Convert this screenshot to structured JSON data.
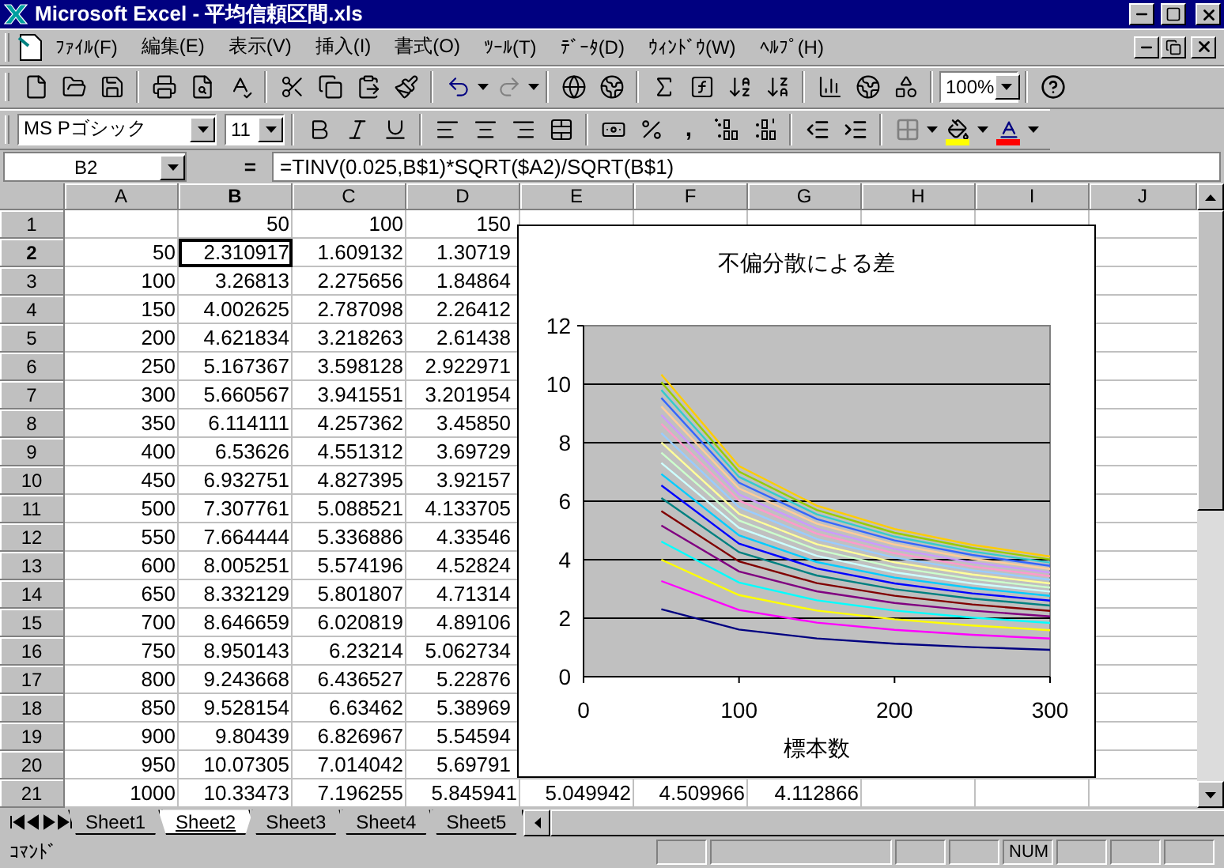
{
  "window": {
    "title": "Microsoft Excel - 平均信頼区間.xls"
  },
  "menu": [
    "ﾌｧｲﾙ(F)",
    "編集(E)",
    "表示(V)",
    "挿入(I)",
    "書式(O)",
    "ﾂｰﾙ(T)",
    "ﾃﾞｰﾀ(D)",
    "ｳｨﾝﾄﾞｳ(W)",
    "ﾍﾙﾌﾟ(H)"
  ],
  "toolbar": {
    "zoom": "100%",
    "font": "MS Pゴシック",
    "size": "11",
    "comma": ","
  },
  "formula_bar": {
    "name_box": "B2",
    "equals": "=",
    "formula": "=TINV(0.025,B$1)*SQRT($A2)/SQRT(B$1)"
  },
  "columns": [
    {
      "label": "A",
      "selected": false
    },
    {
      "label": "B",
      "selected": true
    },
    {
      "label": "C",
      "selected": false
    },
    {
      "label": "D",
      "selected": false
    },
    {
      "label": "E",
      "selected": false
    },
    {
      "label": "F",
      "selected": false
    },
    {
      "label": "G",
      "selected": false
    },
    {
      "label": "H",
      "selected": false
    },
    {
      "label": "I",
      "selected": false
    },
    {
      "label": "J",
      "selected": false
    }
  ],
  "rows": [
    {
      "header": "1",
      "selected": false,
      "cells": [
        null,
        "50",
        "100",
        "150"
      ]
    },
    {
      "header": "2",
      "selected": true,
      "cells": [
        "50",
        "2.310917",
        "1.609132",
        "1.30719"
      ]
    },
    {
      "header": "3",
      "selected": false,
      "cells": [
        "100",
        "3.26813",
        "2.275656",
        "1.84864"
      ]
    },
    {
      "header": "4",
      "selected": false,
      "cells": [
        "150",
        "4.002625",
        "2.787098",
        "2.26412"
      ]
    },
    {
      "header": "5",
      "selected": false,
      "cells": [
        "200",
        "4.621834",
        "3.218263",
        "2.61438"
      ]
    },
    {
      "header": "6",
      "selected": false,
      "cells": [
        "250",
        "5.167367",
        "3.598128",
        "2.922971"
      ]
    },
    {
      "header": "7",
      "selected": false,
      "cells": [
        "300",
        "5.660567",
        "3.941551",
        "3.201954"
      ]
    },
    {
      "header": "8",
      "selected": false,
      "cells": [
        "350",
        "6.114111",
        "4.257362",
        "3.45850"
      ]
    },
    {
      "header": "9",
      "selected": false,
      "cells": [
        "400",
        "6.53626",
        "4.551312",
        "3.69729"
      ]
    },
    {
      "header": "10",
      "selected": false,
      "cells": [
        "450",
        "6.932751",
        "4.827395",
        "3.92157"
      ]
    },
    {
      "header": "11",
      "selected": false,
      "cells": [
        "500",
        "7.307761",
        "5.088521",
        "4.133705"
      ]
    },
    {
      "header": "12",
      "selected": false,
      "cells": [
        "550",
        "7.664444",
        "5.336886",
        "4.33546"
      ]
    },
    {
      "header": "13",
      "selected": false,
      "cells": [
        "600",
        "8.005251",
        "5.574196",
        "4.52824"
      ]
    },
    {
      "header": "14",
      "selected": false,
      "cells": [
        "650",
        "8.332129",
        "5.801807",
        "4.71314"
      ]
    },
    {
      "header": "15",
      "selected": false,
      "cells": [
        "700",
        "8.646659",
        "6.020819",
        "4.89106"
      ]
    },
    {
      "header": "16",
      "selected": false,
      "cells": [
        "750",
        "8.950143",
        "6.23214",
        "5.062734"
      ]
    },
    {
      "header": "17",
      "selected": false,
      "cells": [
        "800",
        "9.243668",
        "6.436527",
        "5.22876"
      ]
    },
    {
      "header": "18",
      "selected": false,
      "cells": [
        "850",
        "9.528154",
        "6.63462",
        "5.38969"
      ]
    },
    {
      "header": "19",
      "selected": false,
      "cells": [
        "900",
        "9.80439",
        "6.826967",
        "5.54594"
      ]
    },
    {
      "header": "20",
      "selected": false,
      "cells": [
        "950",
        "10.07305",
        "7.014042",
        "5.69791"
      ]
    },
    {
      "header": "21",
      "selected": false,
      "cells": [
        "1000",
        "10.33473",
        "7.196255",
        "5.845941",
        "5.049942",
        "4.509966",
        "4.112866"
      ]
    }
  ],
  "chart": {
    "chart_data": {
      "type": "line",
      "grid": true,
      "title": "不偏分散による差",
      "xlabel": "標本数",
      "x": [
        50,
        100,
        150,
        200,
        250,
        300
      ],
      "xlim": [
        0,
        300
      ],
      "ylim": [
        0,
        12
      ],
      "xticks": [
        0,
        100,
        200,
        300
      ],
      "yticks": [
        0,
        2,
        4,
        6,
        8,
        10,
        12
      ],
      "series": [
        {
          "color": "#000080",
          "values": [
            2.31,
            1.61,
            1.31,
            1.13,
            1.01,
            0.92
          ]
        },
        {
          "color": "#ff00ff",
          "values": [
            3.27,
            2.28,
            1.85,
            1.6,
            1.43,
            1.3
          ]
        },
        {
          "color": "#ffff00",
          "values": [
            4.0,
            2.79,
            2.26,
            1.96,
            1.75,
            1.59
          ]
        },
        {
          "color": "#00ffff",
          "values": [
            4.62,
            3.22,
            2.61,
            2.26,
            2.02,
            1.84
          ]
        },
        {
          "color": "#800080",
          "values": [
            5.17,
            3.6,
            2.92,
            2.52,
            2.26,
            2.06
          ]
        },
        {
          "color": "#800000",
          "values": [
            5.66,
            3.94,
            3.2,
            2.77,
            2.47,
            2.25
          ]
        },
        {
          "color": "#008080",
          "values": [
            6.11,
            4.26,
            3.46,
            2.99,
            2.67,
            2.43
          ]
        },
        {
          "color": "#0000ff",
          "values": [
            6.54,
            4.55,
            3.7,
            3.19,
            2.85,
            2.6
          ]
        },
        {
          "color": "#00ccff",
          "values": [
            6.93,
            4.83,
            3.92,
            3.39,
            3.03,
            2.76
          ]
        },
        {
          "color": "#ccffff",
          "values": [
            7.31,
            5.09,
            4.13,
            3.57,
            3.19,
            2.91
          ]
        },
        {
          "color": "#ccffcc",
          "values": [
            7.66,
            5.34,
            4.34,
            3.74,
            3.34,
            3.05
          ]
        },
        {
          "color": "#ffff99",
          "values": [
            8.01,
            5.57,
            4.53,
            3.91,
            3.49,
            3.19
          ]
        },
        {
          "color": "#99ccff",
          "values": [
            8.33,
            5.8,
            4.71,
            4.07,
            3.64,
            3.32
          ]
        },
        {
          "color": "#ff99cc",
          "values": [
            8.65,
            6.02,
            4.89,
            4.22,
            3.77,
            3.44
          ]
        },
        {
          "color": "#cc99ff",
          "values": [
            8.95,
            6.23,
            5.06,
            4.37,
            3.91,
            3.56
          ]
        },
        {
          "color": "#ffcc99",
          "values": [
            9.24,
            6.44,
            5.23,
            4.52,
            4.03,
            3.68
          ]
        },
        {
          "color": "#3366ff",
          "values": [
            9.53,
            6.63,
            5.39,
            4.66,
            4.16,
            3.79
          ]
        },
        {
          "color": "#33cccc",
          "values": [
            9.8,
            6.83,
            5.55,
            4.79,
            4.28,
            3.9
          ]
        },
        {
          "color": "#99cc00",
          "values": [
            10.07,
            7.01,
            5.7,
            4.92,
            4.4,
            4.01
          ]
        },
        {
          "color": "#ffcc00",
          "values": [
            10.33,
            7.2,
            5.85,
            5.05,
            4.51,
            4.11
          ]
        }
      ]
    }
  },
  "sheet_tabs": [
    {
      "label": "Sheet1",
      "selected": false
    },
    {
      "label": "Sheet2",
      "selected": true
    },
    {
      "label": "Sheet3",
      "selected": false
    },
    {
      "label": "Sheet4",
      "selected": false
    },
    {
      "label": "Sheet5",
      "selected": false
    }
  ],
  "status_bar": {
    "message": "ｺﾏﾝﾄﾞ",
    "indicators": [
      "NUM"
    ]
  }
}
